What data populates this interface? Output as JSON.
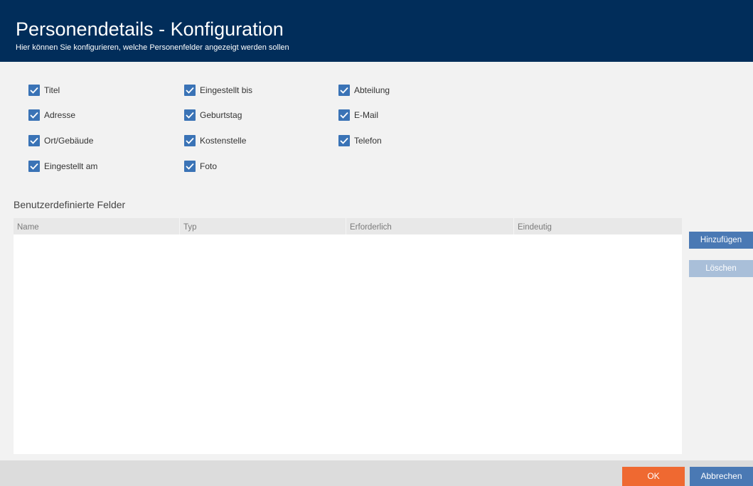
{
  "header": {
    "title": "Personendetails - Konfiguration",
    "subtitle": "Hier können Sie konfigurieren, welche Personenfelder angezeigt werden sollen"
  },
  "checkboxes": [
    {
      "label": "Titel",
      "checked": true
    },
    {
      "label": "Adresse",
      "checked": true
    },
    {
      "label": "Ort/Gebäude",
      "checked": true
    },
    {
      "label": "Eingestellt am",
      "checked": true
    },
    {
      "label": "Eingestellt bis",
      "checked": true
    },
    {
      "label": "Geburtstag",
      "checked": true
    },
    {
      "label": "Kostenstelle",
      "checked": true
    },
    {
      "label": "Foto",
      "checked": true
    },
    {
      "label": "Abteilung",
      "checked": true
    },
    {
      "label": "E-Mail",
      "checked": true
    },
    {
      "label": "Telefon",
      "checked": true
    }
  ],
  "custom_fields": {
    "title": "Benutzerdefinierte Felder",
    "columns": [
      "Name",
      "Typ",
      "Erforderlich",
      "Eindeutig"
    ],
    "rows": []
  },
  "actions": {
    "add_label": "Hinzufügen",
    "delete_label": "Löschen"
  },
  "footer": {
    "ok_label": "OK",
    "cancel_label": "Abbrechen"
  },
  "colors": {
    "header_bg": "#012d5a",
    "checkbox": "#3a73b6",
    "primary_button": "#4a79b4",
    "disabled_button": "#a9bfd9",
    "ok_button": "#ef6931"
  }
}
